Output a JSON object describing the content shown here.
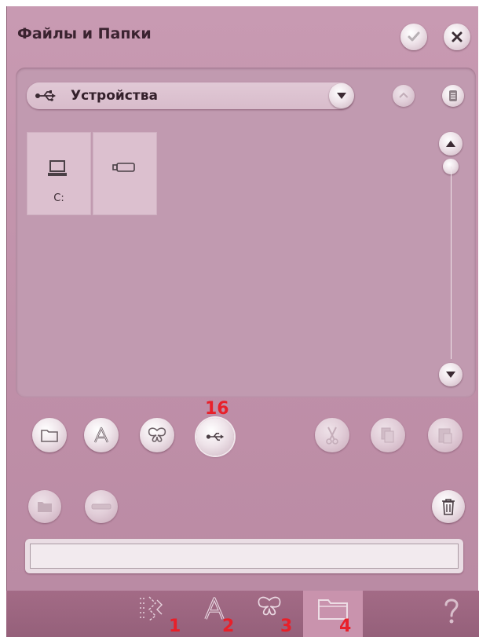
{
  "window": {
    "title": "Файлы и Папки"
  },
  "device_selector": {
    "label": "Устройства"
  },
  "files": [
    {
      "label": "C:"
    },
    {
      "label": ""
    }
  ],
  "annotations": {
    "usb_button": "16",
    "tab_1": "1",
    "tab_2": "2",
    "tab_3": "3",
    "tab_4": "4"
  },
  "path_field": {
    "value": ""
  },
  "bottom_tabs": [
    {
      "icon": "stitch-icon",
      "active": false
    },
    {
      "icon": "font-icon",
      "active": false
    },
    {
      "icon": "butterfly-icon",
      "active": false
    },
    {
      "icon": "folder-icon",
      "active": true
    }
  ],
  "colors": {
    "window_bg": "#c89ab2",
    "panel_bg": "#c19ab0",
    "bottom_bar": "#9b6480",
    "active_tab": "#c993ad",
    "annotation": "#e8202a"
  }
}
